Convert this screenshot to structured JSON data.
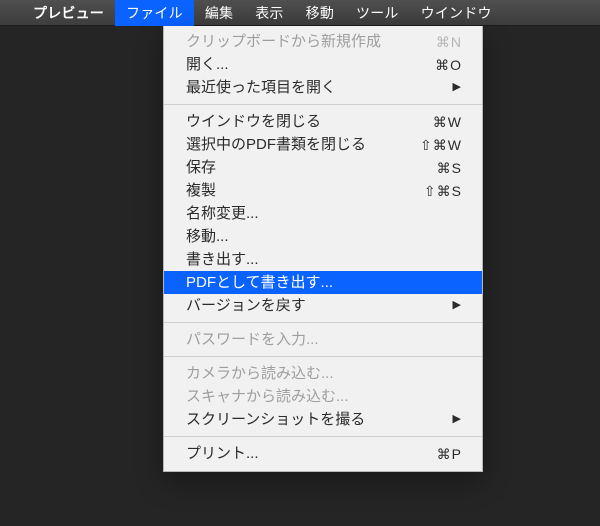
{
  "menubar": {
    "app": "プレビュー",
    "items": [
      {
        "label": "ファイル",
        "active": true
      },
      {
        "label": "編集"
      },
      {
        "label": "表示"
      },
      {
        "label": "移動"
      },
      {
        "label": "ツール"
      },
      {
        "label": "ウインドウ"
      }
    ]
  },
  "file_menu": {
    "groups": [
      [
        {
          "label": "クリップボードから新規作成",
          "shortcut": "⌘N",
          "disabled": true
        },
        {
          "label": "開く...",
          "shortcut": "⌘O"
        },
        {
          "label": "最近使った項目を開く",
          "submenu": true
        }
      ],
      [
        {
          "label": "ウインドウを閉じる",
          "shortcut": "⌘W"
        },
        {
          "label": "選択中のPDF書類を閉じる",
          "shortcut": "⇧⌘W"
        },
        {
          "label": "保存",
          "shortcut": "⌘S"
        },
        {
          "label": "複製",
          "shortcut": "⇧⌘S"
        },
        {
          "label": "名称変更..."
        },
        {
          "label": "移動..."
        },
        {
          "label": "書き出す..."
        },
        {
          "label": "PDFとして書き出す...",
          "highlight": true
        },
        {
          "label": "バージョンを戻す",
          "submenu": true
        }
      ],
      [
        {
          "label": "パスワードを入力...",
          "disabled": true
        }
      ],
      [
        {
          "label": "カメラから読み込む...",
          "disabled": true
        },
        {
          "label": "スキャナから読み込む...",
          "disabled": true
        },
        {
          "label": "スクリーンショットを撮る",
          "submenu": true
        }
      ],
      [
        {
          "label": "プリント...",
          "shortcut": "⌘P"
        }
      ]
    ]
  },
  "glyphs": {
    "submenu_arrow": "▶"
  }
}
